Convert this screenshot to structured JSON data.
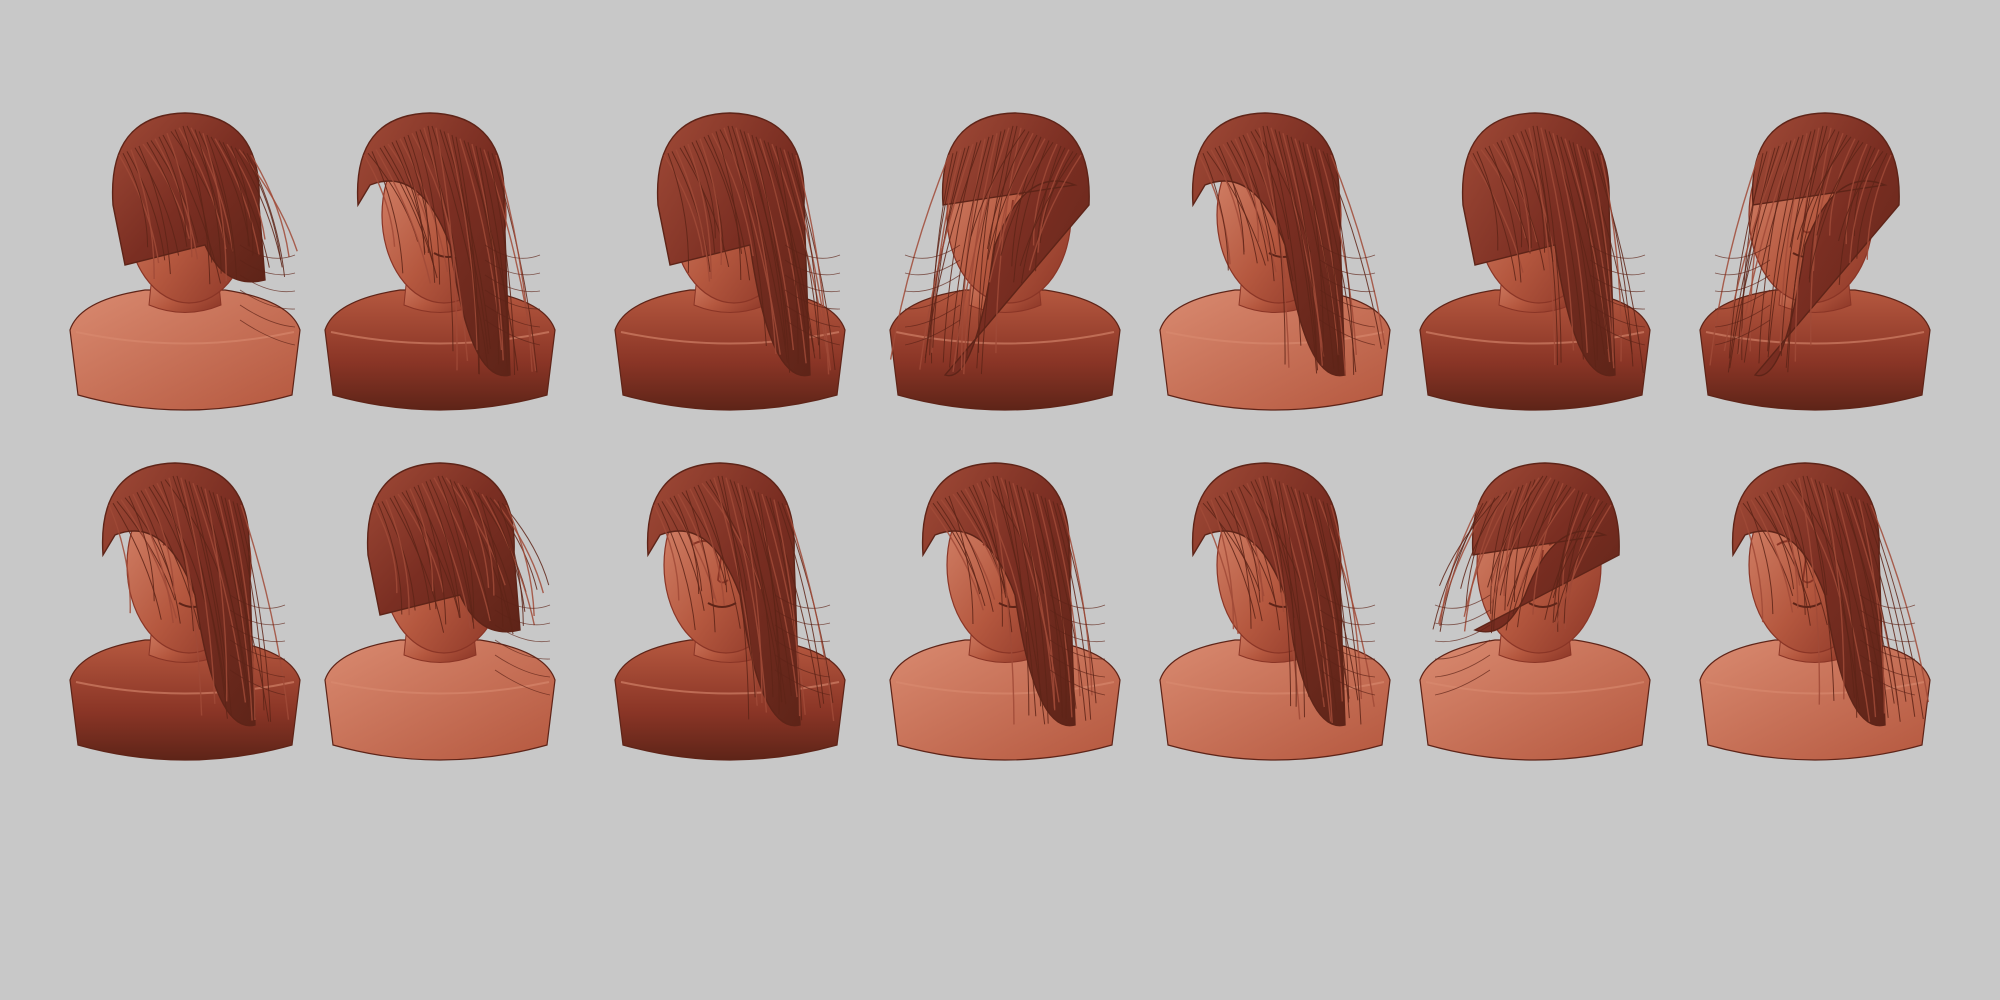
{
  "scene": {
    "background": "#c8c8c8",
    "material": {
      "base": "#b5583f",
      "shade": "#8a3526",
      "deep": "#5e2418",
      "light": "#d98a70",
      "hair": "#7a2e22",
      "hair_light": "#a04a37"
    },
    "rows": [
      {
        "row": "top",
        "views": [
          {
            "id": "t1",
            "view": "back",
            "hair": "short-right",
            "bust": "light"
          },
          {
            "id": "t2",
            "view": "three-quarter-right",
            "hair": "long-right",
            "bust": "dark"
          },
          {
            "id": "t3",
            "view": "profile-left-back",
            "hair": "long-right",
            "bust": "dark"
          },
          {
            "id": "t4",
            "view": "front-up",
            "hair": "long-left",
            "bust": "dark"
          },
          {
            "id": "t5",
            "view": "front",
            "hair": "long-right",
            "bust": "light"
          },
          {
            "id": "t6",
            "view": "profile-right-back",
            "hair": "long-right",
            "bust": "dark"
          },
          {
            "id": "t7",
            "view": "tilted-left",
            "hair": "long-left",
            "bust": "dark"
          }
        ]
      },
      {
        "row": "bottom",
        "views": [
          {
            "id": "b1",
            "view": "three-quarter-right",
            "hair": "long-right",
            "bust": "dark"
          },
          {
            "id": "b2",
            "view": "back-tilted",
            "hair": "short-right",
            "bust": "light"
          },
          {
            "id": "b3",
            "view": "three-quarter-left",
            "hair": "long-right",
            "bust": "dark"
          },
          {
            "id": "b4",
            "view": "three-quarter-right",
            "hair": "long-right",
            "bust": "light"
          },
          {
            "id": "b5",
            "view": "front",
            "hair": "long-right",
            "bust": "light"
          },
          {
            "id": "b6",
            "view": "down-tilted",
            "hair": "short-left",
            "bust": "light"
          },
          {
            "id": "b7",
            "view": "three-quarter-left",
            "hair": "long-right",
            "bust": "light"
          }
        ]
      }
    ]
  }
}
